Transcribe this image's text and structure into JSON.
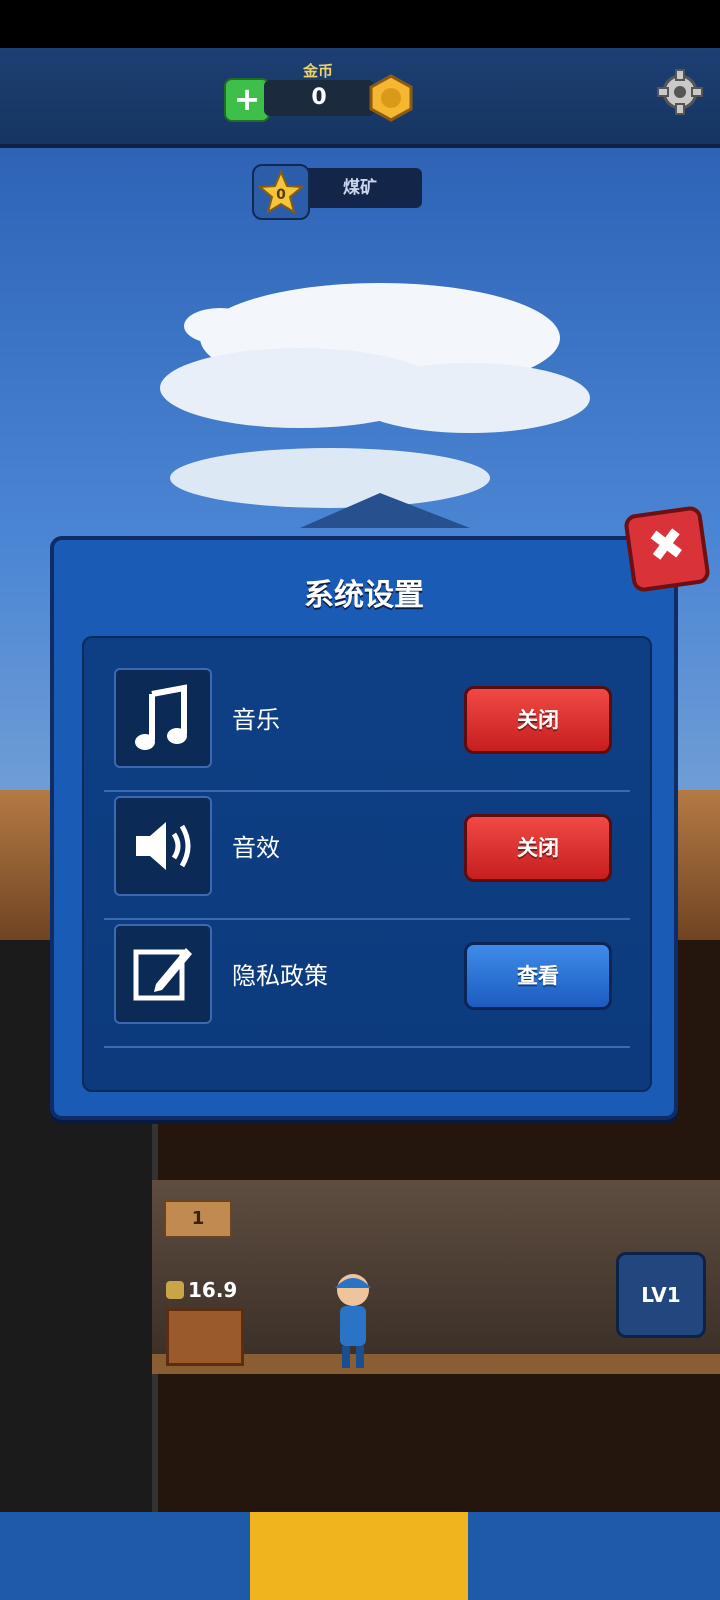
{
  "header": {
    "coin_title": "金币",
    "coin_value": "0",
    "plus_label": "+",
    "mine_star_value": "0",
    "mine_name": "煤矿"
  },
  "game": {
    "level_sign": "1",
    "cash_value": "16.9",
    "lv_label": "LV1"
  },
  "dialog": {
    "title": "系统设置",
    "close_symbol": "✖",
    "rows": [
      {
        "label": "音乐",
        "button": "关闭",
        "icon": "music-note-icon"
      },
      {
        "label": "音效",
        "button": "关闭",
        "icon": "speaker-icon"
      },
      {
        "label": "隐私政策",
        "button": "查看",
        "icon": "edit-icon"
      }
    ]
  },
  "colors": {
    "dialog_bg": "#1a5bb5",
    "red_button": "#e03a36",
    "blue_button": "#2f73d6",
    "coin_gold": "#f5b731"
  }
}
